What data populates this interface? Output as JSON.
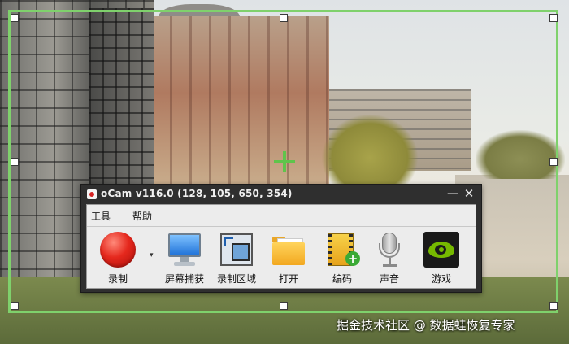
{
  "window": {
    "title": "oCam v116.0 (128, 105, 650, 354)",
    "minimize_glyph": "—",
    "close_glyph": "✕"
  },
  "menu": {
    "tools": "工具",
    "help": "帮助"
  },
  "toolbar": {
    "record": {
      "label": "录制",
      "icon": "record-icon"
    },
    "record_dropdown_glyph": "▾",
    "screenshot": {
      "label": "屏幕捕获",
      "icon": "monitor-icon"
    },
    "region": {
      "label": "录制区域",
      "icon": "region-icon"
    },
    "open": {
      "label": "打开",
      "icon": "folder-icon"
    },
    "codec": {
      "label": "编码",
      "icon": "film-plus-icon"
    },
    "audio": {
      "label": "声音",
      "icon": "microphone-icon"
    },
    "game": {
      "label": "游戏",
      "icon": "nvidia-icon"
    }
  },
  "capture": {
    "frame_color": "#7fd16c"
  },
  "watermark": "掘金技术社区 @ 数据蛙恢复专家"
}
